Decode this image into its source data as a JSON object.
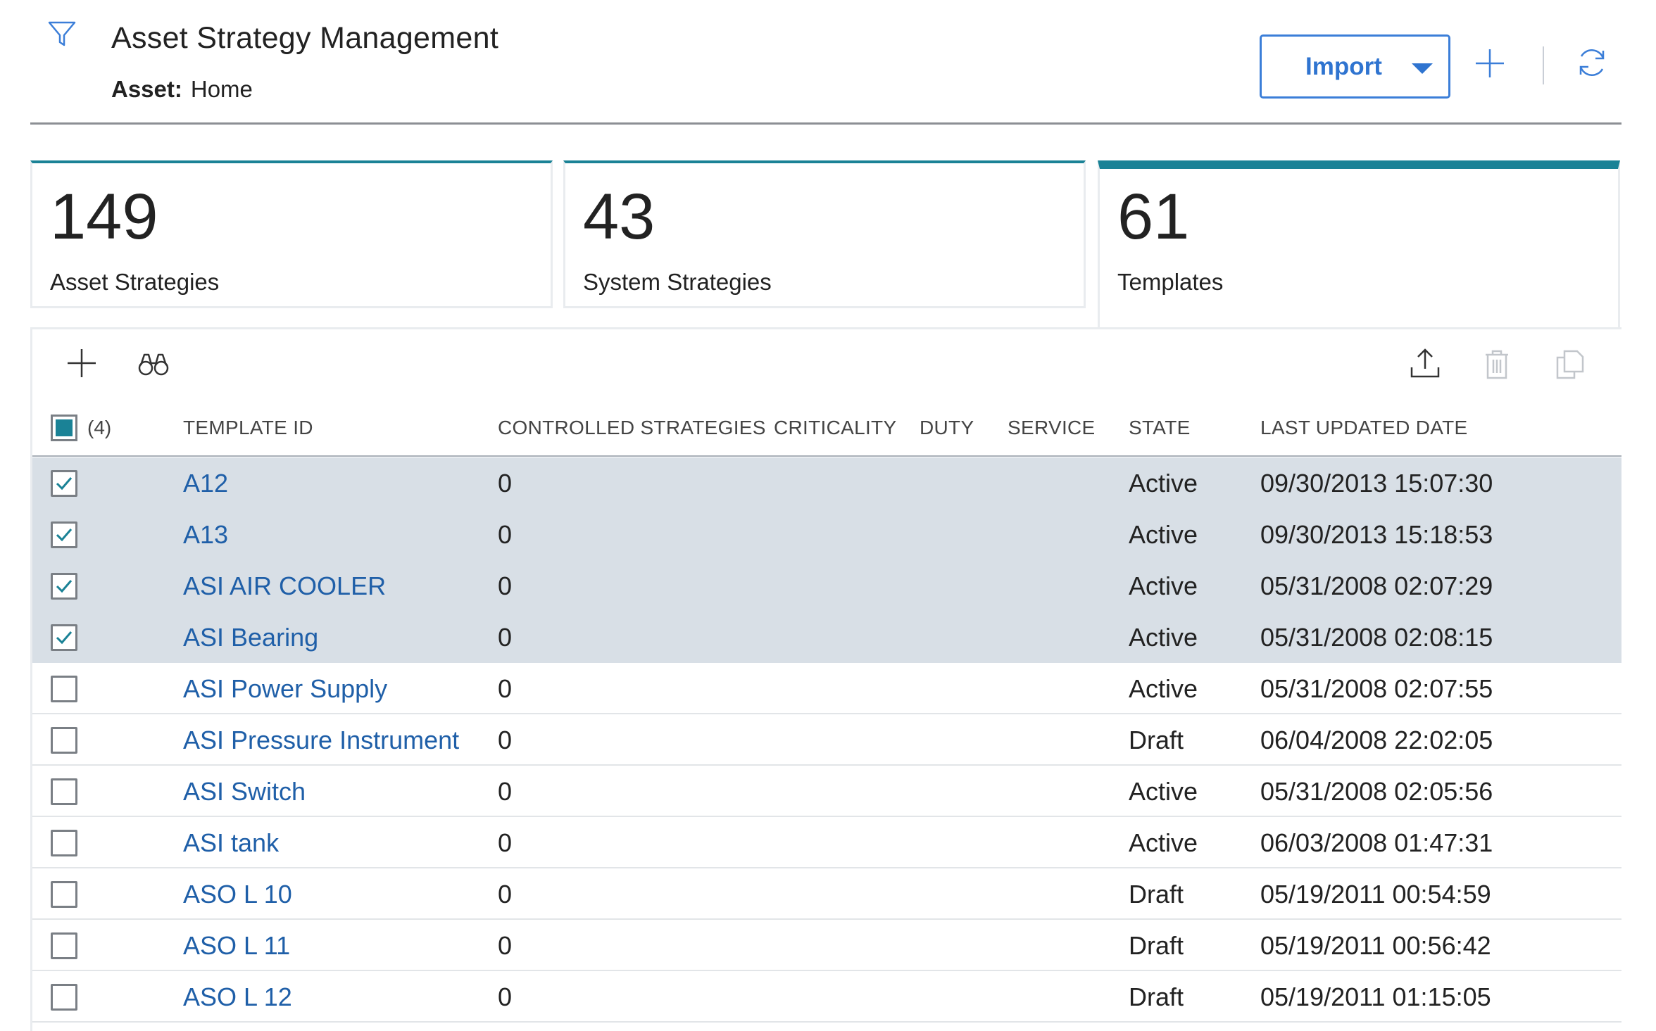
{
  "header": {
    "title": "Asset Strategy Management",
    "asset_label": "Asset:",
    "asset_value": "Home",
    "import_label": "Import"
  },
  "cards": [
    {
      "count": "149",
      "label": "Asset Strategies"
    },
    {
      "count": "43",
      "label": "System Strategies"
    },
    {
      "count": "61",
      "label": "Templates"
    }
  ],
  "grid": {
    "selected_count": "(4)",
    "columns": {
      "template_id": "TEMPLATE ID",
      "controlled": "CONTROLLED STRATEGIES",
      "criticality": "CRITICALITY",
      "duty": "DUTY",
      "service": "SERVICE",
      "state": "STATE",
      "last_updated": "LAST UPDATED DATE"
    },
    "rows": [
      {
        "id": "A12",
        "controlled": "0",
        "state": "Active",
        "date": "09/30/2013 15:07:30",
        "checked": true
      },
      {
        "id": "A13",
        "controlled": "0",
        "state": "Active",
        "date": "09/30/2013 15:18:53",
        "checked": true
      },
      {
        "id": "ASI AIR COOLER",
        "controlled": "0",
        "state": "Active",
        "date": "05/31/2008 02:07:29",
        "checked": true
      },
      {
        "id": "ASI Bearing",
        "controlled": "0",
        "state": "Active",
        "date": "05/31/2008 02:08:15",
        "checked": true
      },
      {
        "id": "ASI Power Supply",
        "controlled": "0",
        "state": "Active",
        "date": "05/31/2008 02:07:55",
        "checked": false
      },
      {
        "id": "ASI Pressure Instrument",
        "controlled": "0",
        "state": "Draft",
        "date": "06/04/2008 22:02:05",
        "checked": false
      },
      {
        "id": "ASI Switch",
        "controlled": "0",
        "state": "Active",
        "date": "05/31/2008 02:05:56",
        "checked": false
      },
      {
        "id": "ASI tank",
        "controlled": "0",
        "state": "Active",
        "date": "06/03/2008 01:47:31",
        "checked": false
      },
      {
        "id": "ASO L 10",
        "controlled": "0",
        "state": "Draft",
        "date": "05/19/2011 00:54:59",
        "checked": false
      },
      {
        "id": "ASO L 11",
        "controlled": "0",
        "state": "Draft",
        "date": "05/19/2011 00:56:42",
        "checked": false
      },
      {
        "id": "ASO L 12",
        "controlled": "0",
        "state": "Draft",
        "date": "05/19/2011 01:15:05",
        "checked": false
      }
    ]
  },
  "colors": {
    "accent": "#1a8296",
    "link": "#1f5fa8",
    "button_blue": "#2f74d0",
    "selected_row": "#d8dfe6"
  },
  "icons": [
    "filter-icon",
    "plus-icon",
    "refresh-icon",
    "binoculars-icon",
    "upload-icon",
    "trash-icon",
    "copy-icon",
    "checkmark-icon",
    "caret-down-icon"
  ]
}
